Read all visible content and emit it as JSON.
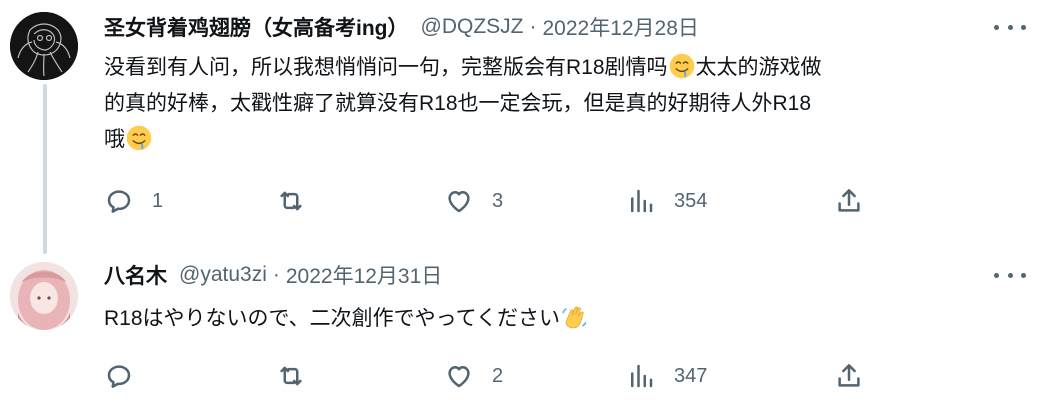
{
  "tweets": [
    {
      "author_name": "圣女背着鸡翅膀（女高备考ing）",
      "handle": "@DQZSJZ",
      "separator": "·",
      "date": "2022年12月28日",
      "text_lines": [
        "没看到有人问，所以我想悄悄问一句，完整版会有R18剧情吗",
        "太太的游戏做",
        "的真的好棒，太戳性癖了就算没有R18也一定会玩，但是真的好期待人外R18",
        "哦"
      ],
      "emoji": "drooling-face",
      "replies": "1",
      "retweets": "",
      "likes": "3",
      "views": "354"
    },
    {
      "author_name": "八名木",
      "handle": "@yatu3zi",
      "separator": "·",
      "date": "2022年12月31日",
      "text": "R18はやりないので、二次創作でやってください",
      "emoji": "waving-hand",
      "replies": "",
      "retweets": "",
      "likes": "2",
      "views": "347"
    }
  ],
  "colors": {
    "text": "#0f1419",
    "secondary": "#536471",
    "thread_line": "#cfd9de"
  }
}
